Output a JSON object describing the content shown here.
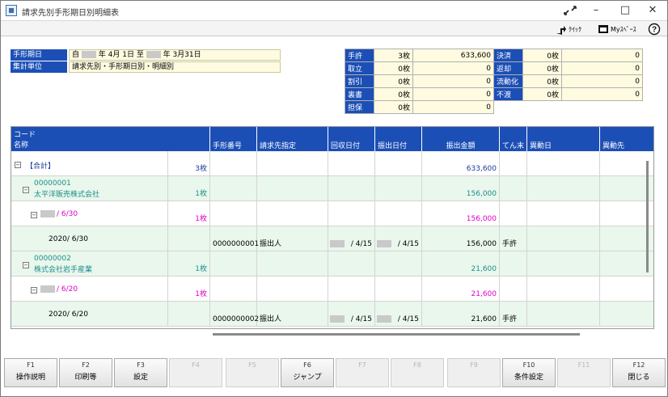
{
  "window": {
    "title": "請求先別手形期日別明細表"
  },
  "toolbar": {
    "quick": "ｸｲｯｸ",
    "myspace": "Myｽﾍﾟｰｽ",
    "help": "?"
  },
  "header": {
    "due_label": "手形期日",
    "due_from_prefix": "自",
    "due_from": "年 4月 1日",
    "due_to_prefix": "至",
    "due_to": "年 3月31日",
    "unit_label": "集計単位",
    "unit_value": "請求先別・手形期日別・明細別"
  },
  "summary": [
    {
      "label": "手許",
      "count": "3枚",
      "amount": "633,600",
      "label2": "決済",
      "count2": "0枚",
      "amount2": "0"
    },
    {
      "label": "取立",
      "count": "0枚",
      "amount": "0",
      "label2": "返却",
      "count2": "0枚",
      "amount2": "0"
    },
    {
      "label": "割引",
      "count": "0枚",
      "amount": "0",
      "label2": "流動化",
      "count2": "0枚",
      "amount2": "0"
    },
    {
      "label": "裏書",
      "count": "0枚",
      "amount": "0",
      "label2": "不渡",
      "count2": "0枚",
      "amount2": "0"
    },
    {
      "label": "担保",
      "count": "0枚",
      "amount": "0"
    }
  ],
  "grid": {
    "head": {
      "code": "コード",
      "name": "名称",
      "note_no": "手形番号",
      "billing": "請求先指定",
      "collect_date": "回収日付",
      "issue_date": "振出日付",
      "amount": "振出金額",
      "status": "てん末",
      "change_date": "異動日",
      "change_to": "異動先"
    },
    "rows": [
      {
        "type": "total",
        "name": "【合計】",
        "count": "3枚",
        "amount": "633,600"
      },
      {
        "type": "customer",
        "code": "00000001",
        "name": "太平洋販売株式会社",
        "count": "1枚",
        "amount": "156,000"
      },
      {
        "type": "due",
        "name": "/ 6/30",
        "count": "1枚",
        "amount": "156,000"
      },
      {
        "type": "detail",
        "name": "2020/ 6/30",
        "note_no": "0000000001",
        "billing": "振出人",
        "collect_date": "/ 4/15",
        "issue_date": "/ 4/15",
        "amount": "156,000",
        "status": "手許"
      },
      {
        "type": "customer",
        "code": "00000002",
        "name": "株式会社岩手産業",
        "count": "1枚",
        "amount": "21,600"
      },
      {
        "type": "due",
        "name": "/ 6/20",
        "count": "1枚",
        "amount": "21,600"
      },
      {
        "type": "detail",
        "name": "2020/ 6/20",
        "note_no": "0000000002",
        "billing": "振出人",
        "collect_date": "/ 4/15",
        "issue_date": "/ 4/15",
        "amount": "21,600",
        "status": "手許"
      }
    ]
  },
  "fkeys": [
    {
      "key": "F1",
      "label": "操作説明"
    },
    {
      "key": "F2",
      "label": "印刷等"
    },
    {
      "key": "F3",
      "label": "設定"
    },
    {
      "key": "F4",
      "label": ""
    },
    {
      "key": "F5",
      "label": ""
    },
    {
      "key": "F6",
      "label": "ジャンプ"
    },
    {
      "key": "F7",
      "label": ""
    },
    {
      "key": "F8",
      "label": ""
    },
    {
      "key": "F9",
      "label": ""
    },
    {
      "key": "F10",
      "label": "条件設定"
    },
    {
      "key": "F11",
      "label": ""
    },
    {
      "key": "F12",
      "label": "閉じる"
    }
  ],
  "colors": {
    "header_blue": "#1c4fb6",
    "input_yellow": "#fffbe0",
    "row_green": "#eaf7ec",
    "due_pink": "#e000c8",
    "name_teal": "#1a8f8c"
  }
}
